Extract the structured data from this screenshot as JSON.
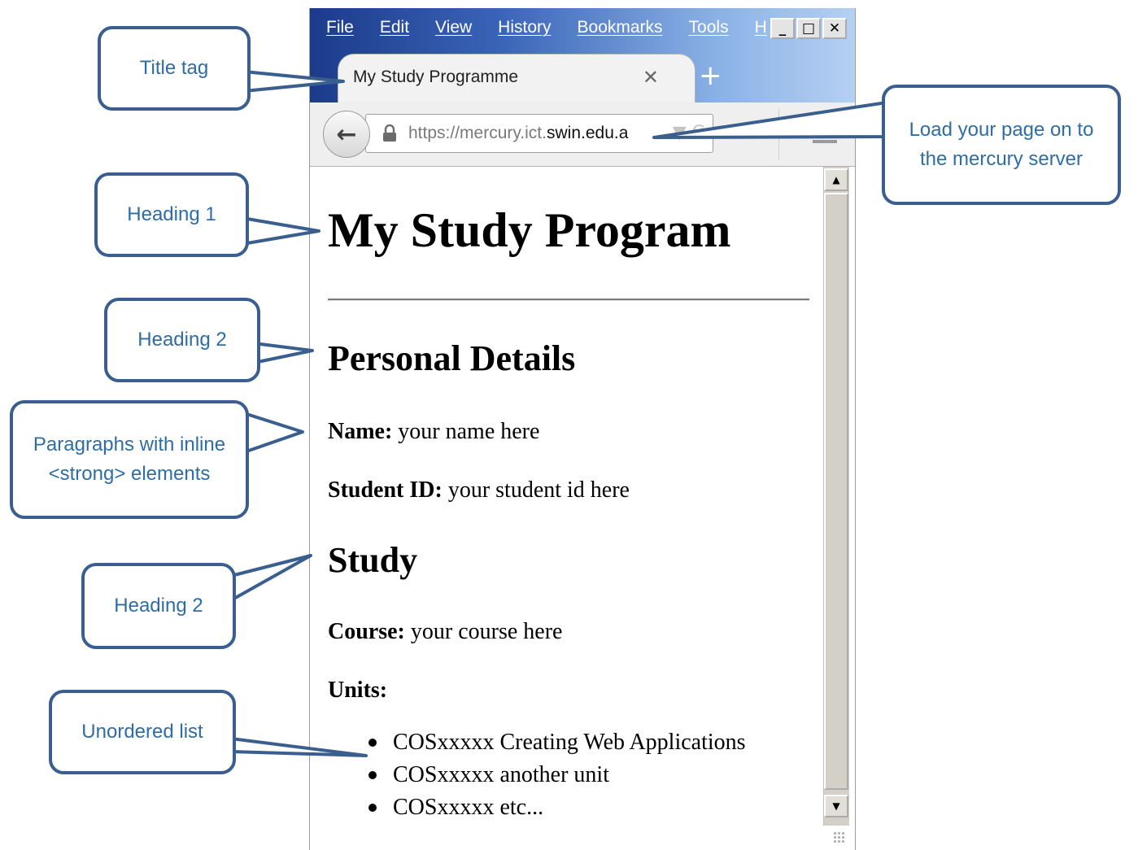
{
  "browser": {
    "menu": [
      "File",
      "Edit",
      "View",
      "History",
      "Bookmarks",
      "Tools",
      "H"
    ],
    "window_buttons": [
      "_",
      "□",
      "✕"
    ],
    "tab_title": "My Study Programme",
    "tab_close": "✕",
    "new_tab": "+",
    "back": "←",
    "url_scheme": "https://mercury.ict.",
    "url_domain": "swin.edu.a",
    "url_tools": "▼ C"
  },
  "page": {
    "h1": "My Study Program",
    "personal_heading": "Personal Details",
    "name_label": "Name:",
    "name_value": " your name here",
    "id_label": "Student ID:",
    "id_value": " your student id here",
    "study_heading": "Study",
    "course_label": "Course:",
    "course_value": " your course here",
    "units_label": "Units:",
    "units": [
      "COSxxxxx Creating Web Applications",
      "COSxxxxx another unit",
      "COSxxxxx etc..."
    ]
  },
  "callouts": {
    "title_tag": "Title tag",
    "heading1": "Heading 1",
    "heading2_a": "Heading 2",
    "paragraphs": "Paragraphs with inline <strong> elements",
    "heading2_b": "Heading 2",
    "unordered": "Unordered list",
    "mercury": "Load your page on to the mercury server"
  },
  "colors": {
    "callout_border": "#3a5f8f",
    "callout_text": "#2e6da4",
    "titlebar": "#1c3a8a"
  }
}
